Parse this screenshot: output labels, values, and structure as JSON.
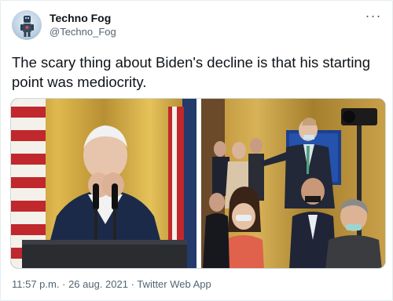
{
  "tweet": {
    "author": {
      "display_name": "Techno Fog",
      "handle": "@Techno_Fog",
      "avatar_icon": "robot-avatar-icon"
    },
    "more_icon": "more-options-icon",
    "more_glyph": "···",
    "text": "The scary thing about Biden's decline is that his starting point was mediocrity.",
    "media": {
      "type": "photo",
      "panels": [
        "left-photo",
        "right-photo"
      ]
    },
    "timestamp": {
      "time": "11:57 p.m.",
      "separator": "·",
      "date": "26 aug. 2021",
      "source": "Twitter Web App"
    }
  },
  "colors": {
    "text_primary": "#0f1419",
    "text_secondary": "#536471",
    "border": "#cfd9de"
  }
}
